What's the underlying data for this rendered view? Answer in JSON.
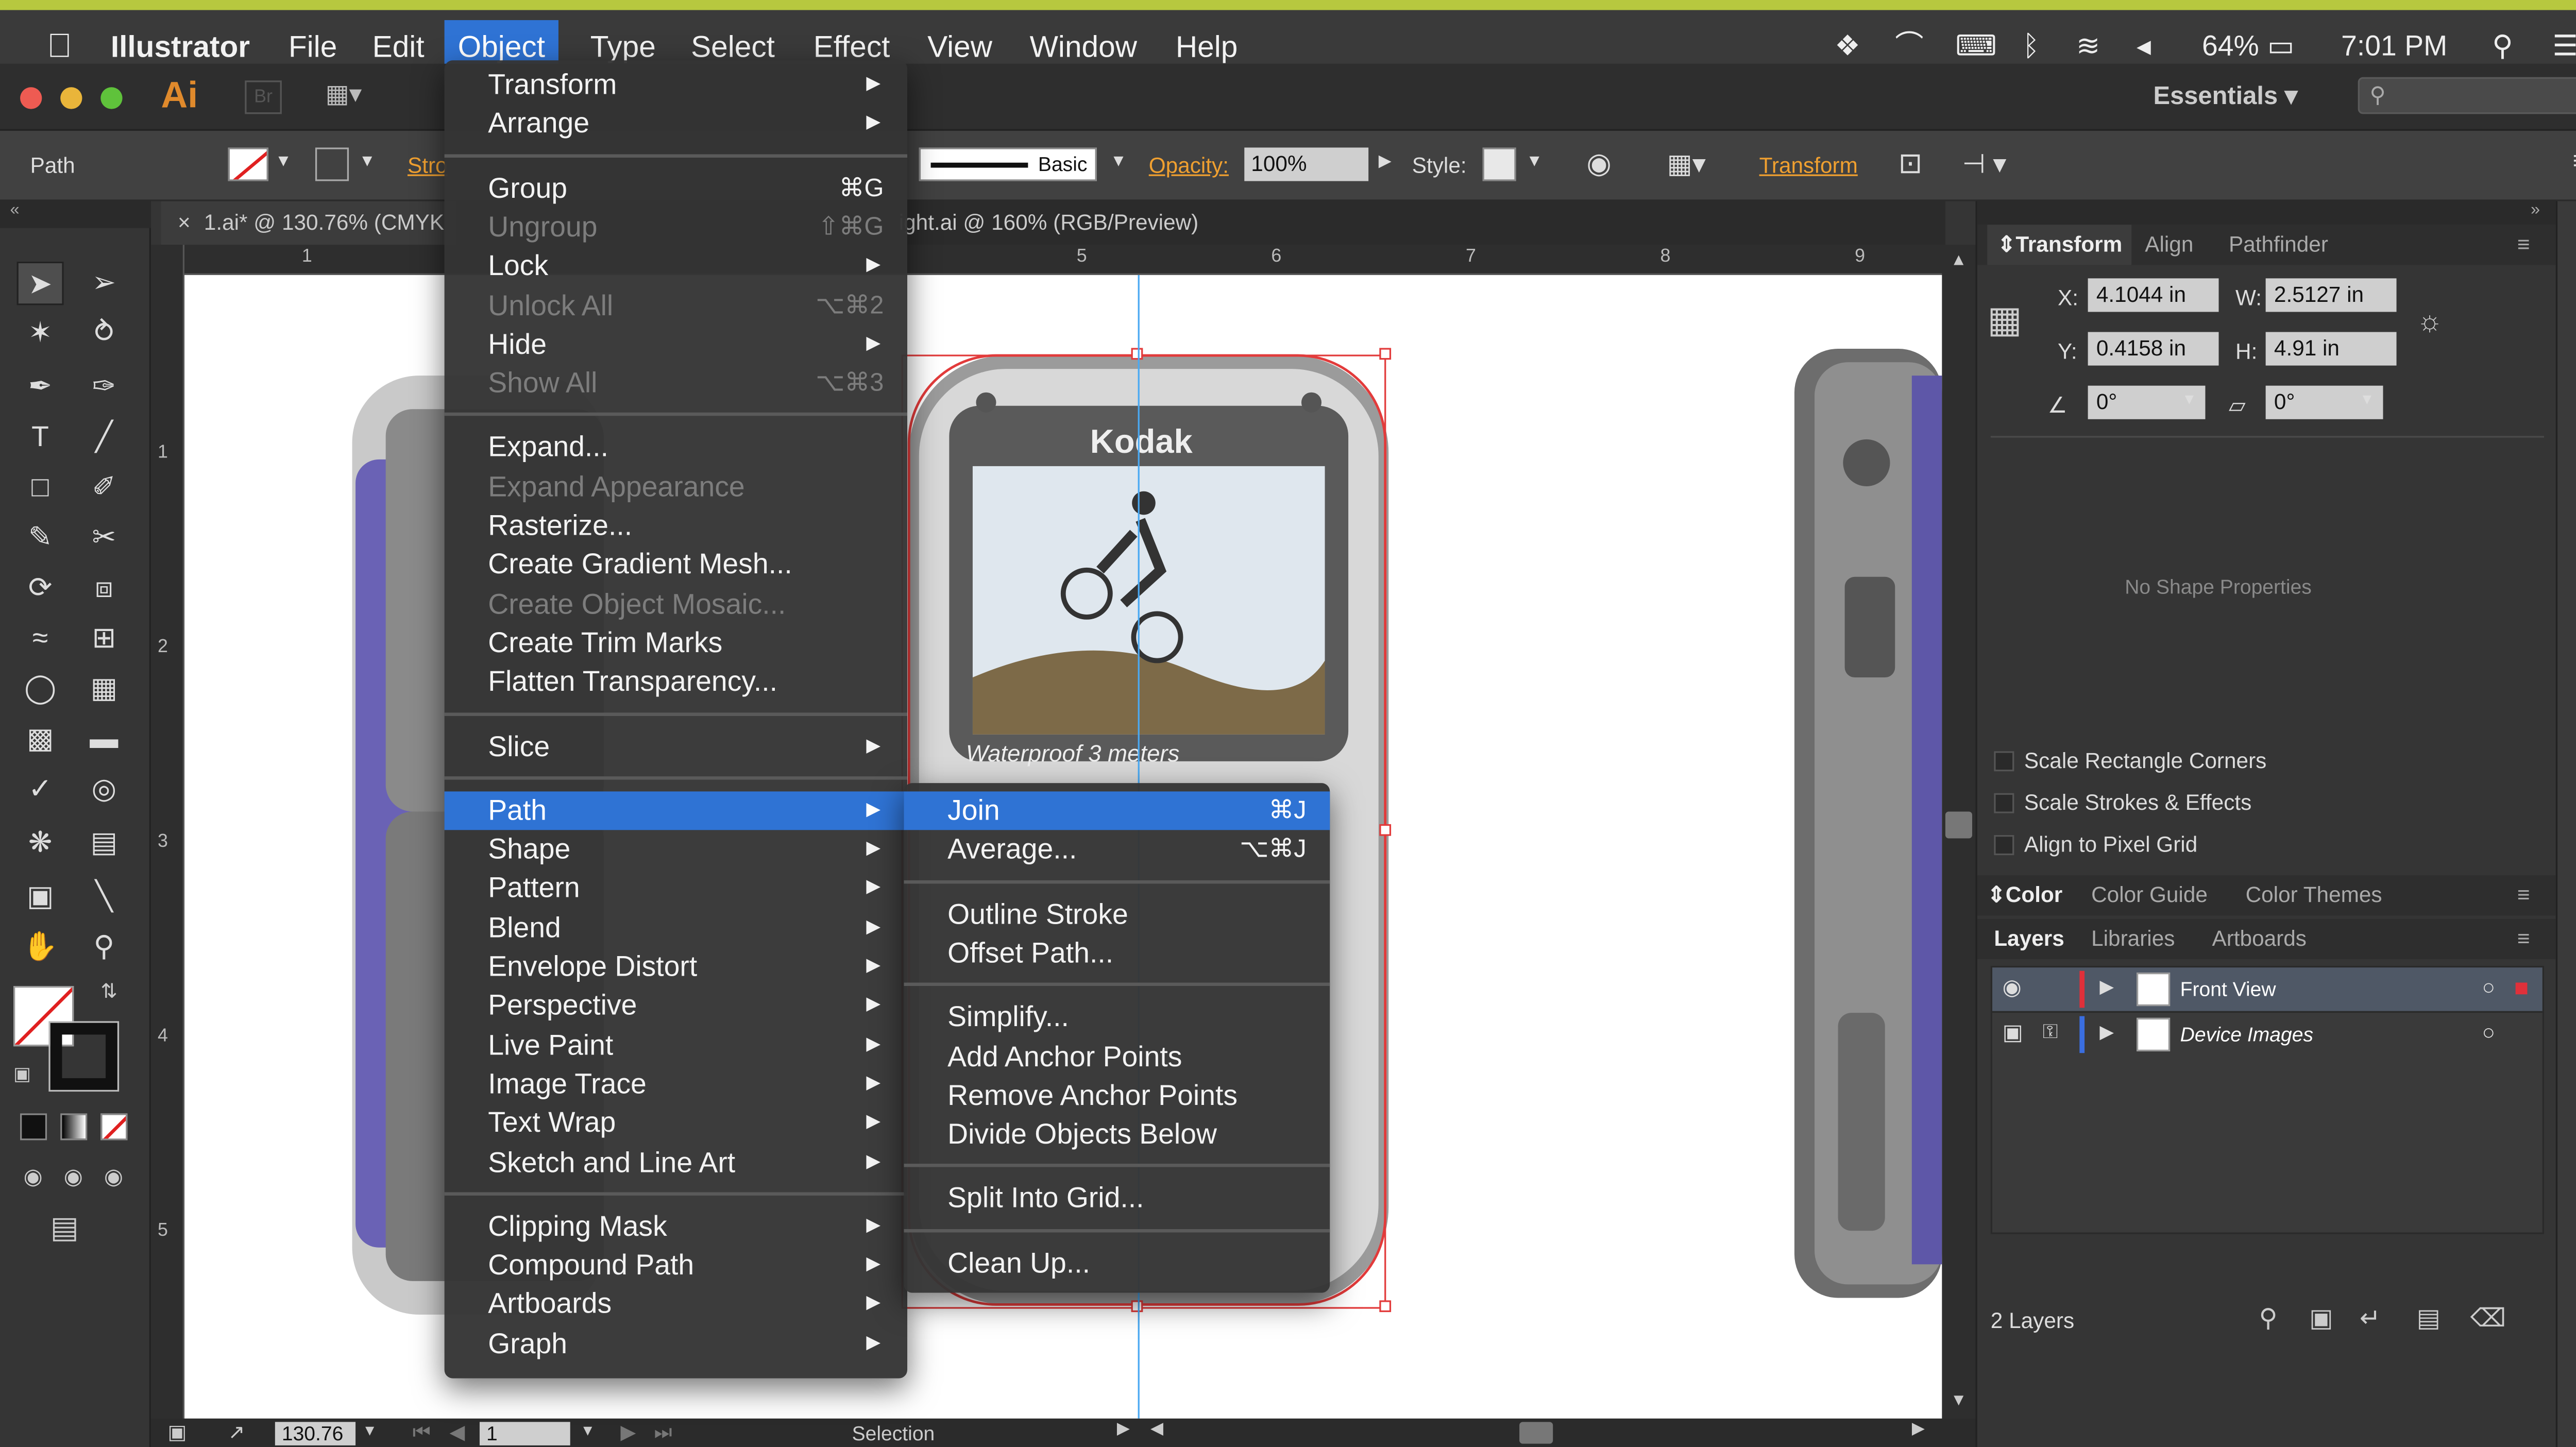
{
  "menubar": {
    "items": [
      "Illustrator",
      "File",
      "Edit",
      "Object",
      "Type",
      "Select",
      "Effect",
      "View",
      "Window",
      "Help"
    ],
    "active": "Object",
    "status": {
      "battery": "64%",
      "time": "7:01 PM"
    }
  },
  "appbar": {
    "logo": "Ai",
    "bridge": "Br",
    "workspace": "Essentials"
  },
  "controlbar": {
    "selection_label": "Path",
    "stroke_label": "Stro",
    "brush": "Basic",
    "opacity_label": "Opacity:",
    "opacity_value": "100%",
    "style_label": "Style:",
    "transform_label": "Transform"
  },
  "tabs": [
    {
      "label": "1.ai* @ 130.76% (CMYK"
    },
    {
      "label": "ight.ai @ 160% (RGB/Preview)"
    }
  ],
  "rulers": {
    "h": [
      "1",
      "5",
      "6",
      "7",
      "8",
      "9"
    ],
    "v": [
      "1",
      "2",
      "3",
      "4",
      "5"
    ]
  },
  "artwork": {
    "brand": "Kodak",
    "caption": "Waterproof 3 meters"
  },
  "statusbar": {
    "zoom": "130.76",
    "artboard": "1",
    "tool": "Selection"
  },
  "object_menu": [
    {
      "label": "Transform",
      "submenu": true
    },
    {
      "label": "Arrange",
      "submenu": true
    },
    {
      "sep": true
    },
    {
      "label": "Group",
      "shortcut": "⌘G"
    },
    {
      "label": "Ungroup",
      "shortcut": "⇧⌘G",
      "disabled": true
    },
    {
      "label": "Lock",
      "submenu": true
    },
    {
      "label": "Unlock All",
      "shortcut": "⌥⌘2",
      "disabled": true
    },
    {
      "label": "Hide",
      "submenu": true
    },
    {
      "label": "Show All",
      "shortcut": "⌥⌘3",
      "disabled": true
    },
    {
      "sep": true
    },
    {
      "label": "Expand..."
    },
    {
      "label": "Expand Appearance",
      "disabled": true
    },
    {
      "label": "Rasterize..."
    },
    {
      "label": "Create Gradient Mesh..."
    },
    {
      "label": "Create Object Mosaic...",
      "disabled": true
    },
    {
      "label": "Create Trim Marks"
    },
    {
      "label": "Flatten Transparency..."
    },
    {
      "sep": true
    },
    {
      "label": "Slice",
      "submenu": true
    },
    {
      "sep": true
    },
    {
      "label": "Path",
      "submenu": true,
      "highlighted": true
    },
    {
      "label": "Shape",
      "submenu": true
    },
    {
      "label": "Pattern",
      "submenu": true
    },
    {
      "label": "Blend",
      "submenu": true
    },
    {
      "label": "Envelope Distort",
      "submenu": true
    },
    {
      "label": "Perspective",
      "submenu": true
    },
    {
      "label": "Live Paint",
      "submenu": true
    },
    {
      "label": "Image Trace",
      "submenu": true
    },
    {
      "label": "Text Wrap",
      "submenu": true
    },
    {
      "label": "Sketch and Line Art",
      "submenu": true
    },
    {
      "sep": true
    },
    {
      "label": "Clipping Mask",
      "submenu": true
    },
    {
      "label": "Compound Path",
      "submenu": true
    },
    {
      "label": "Artboards",
      "submenu": true
    },
    {
      "label": "Graph",
      "submenu": true
    }
  ],
  "path_submenu": [
    {
      "label": "Join",
      "shortcut": "⌘J",
      "highlighted": true
    },
    {
      "label": "Average...",
      "shortcut": "⌥⌘J"
    },
    {
      "sep": true
    },
    {
      "label": "Outline Stroke"
    },
    {
      "label": "Offset Path..."
    },
    {
      "sep": true
    },
    {
      "label": "Simplify..."
    },
    {
      "label": "Add Anchor Points"
    },
    {
      "label": "Remove Anchor Points"
    },
    {
      "label": "Divide Objects Below"
    },
    {
      "sep": true
    },
    {
      "label": "Split Into Grid..."
    },
    {
      "sep": true
    },
    {
      "label": "Clean Up..."
    }
  ],
  "transform_panel": {
    "tabs": [
      "Transform",
      "Align",
      "Pathfinder"
    ],
    "x_label": "X:",
    "x": "4.1044 in",
    "y_label": "Y:",
    "y": "0.4158 in",
    "w_label": "W:",
    "w": "2.5127 in",
    "h_label": "H:",
    "h": "4.91 in",
    "angle": "0°",
    "shear": "0°",
    "no_shape": "No Shape Properties",
    "options": [
      "Scale Rectangle Corners",
      "Scale Strokes & Effects",
      "Align to Pixel Grid"
    ]
  },
  "color_panel": {
    "tabs": [
      "Color",
      "Color Guide",
      "Color Themes"
    ]
  },
  "layers_panel": {
    "tabs": [
      "Layers",
      "Libraries",
      "Artboards"
    ],
    "layers": [
      {
        "name": "Front View",
        "color": "#e0303a"
      },
      {
        "name": "Device Images",
        "color": "#3a6ee0"
      }
    ],
    "count": "2 Layers"
  }
}
